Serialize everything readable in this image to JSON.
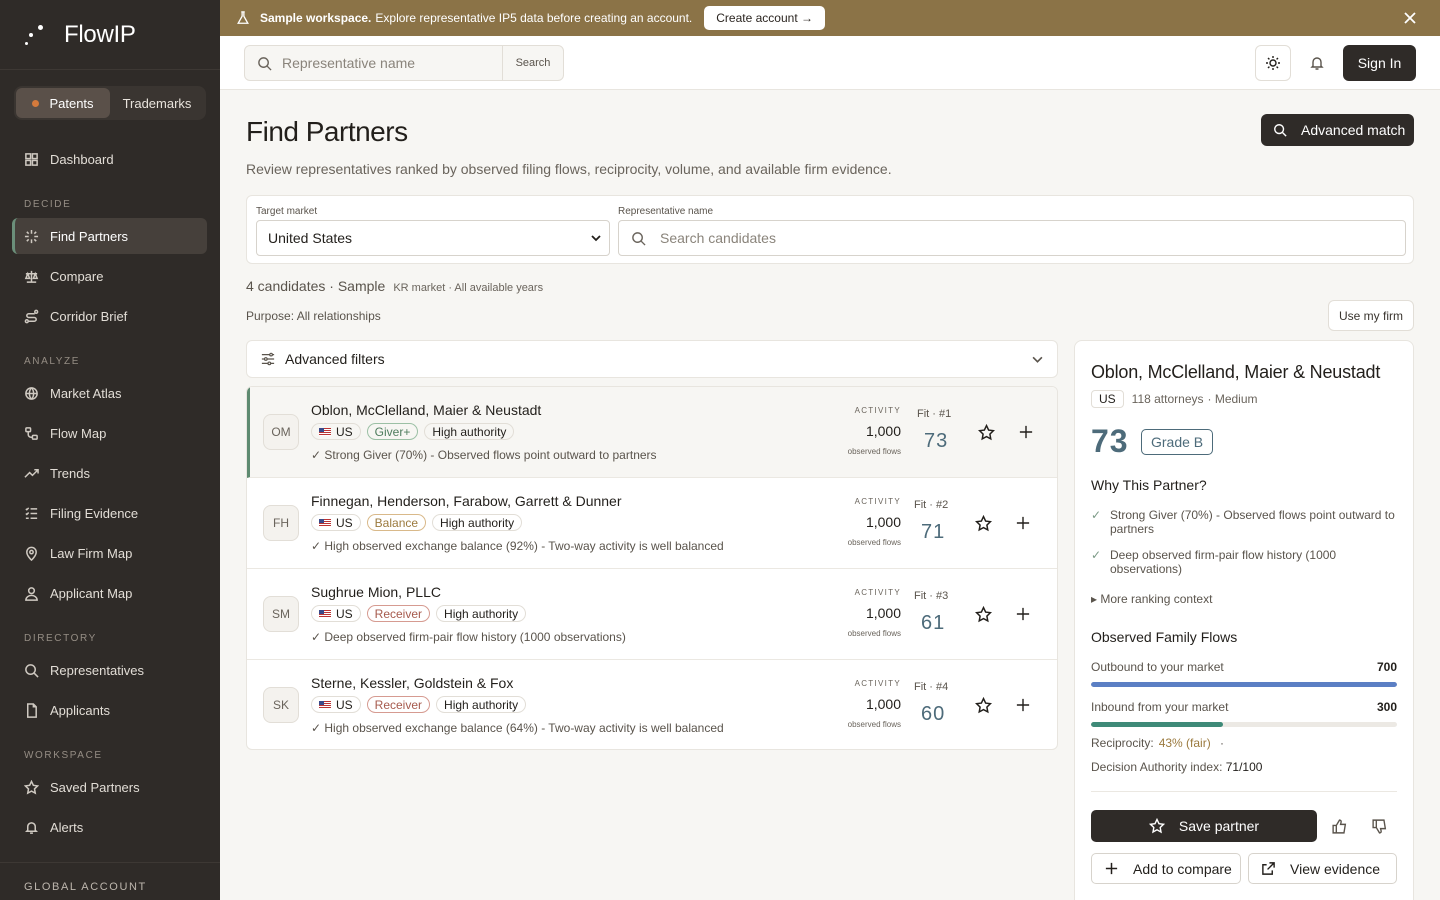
{
  "app": {
    "name": "FlowIP"
  },
  "sidebar": {
    "segments": [
      {
        "label": "Patents"
      },
      {
        "label": "Trademarks"
      }
    ],
    "dashboard": "Dashboard",
    "sections": {
      "decide": "DECIDE",
      "analyze": "ANALYZE",
      "directory": "DIRECTORY",
      "workspace": "WORKSPACE",
      "global": "GLOBAL ACCOUNT"
    },
    "items": {
      "find_partners": "Find Partners",
      "compare": "Compare",
      "corridor_brief": "Corridor Brief",
      "market_atlas": "Market Atlas",
      "flow_map": "Flow Map",
      "trends": "Trends",
      "filing_evidence": "Filing Evidence",
      "law_firm_map": "Law Firm Map",
      "applicant_map": "Applicant Map",
      "representatives": "Representatives",
      "applicants": "Applicants",
      "saved_partners": "Saved Partners",
      "alerts": "Alerts"
    }
  },
  "banner": {
    "strong": "Sample workspace.",
    "text": "Explore representative IP5 data before creating an account.",
    "cta": "Create account →"
  },
  "topbar": {
    "search_placeholder": "Representative name",
    "search_button": "Search",
    "signin": "Sign In"
  },
  "main": {
    "title": "Find Partners",
    "subtitle": "Review representatives ranked by observed filing flows, reciprocity, volume, and available firm evidence.",
    "advanced_match": "Advanced match",
    "filters": {
      "target_label": "Target market",
      "target_value": "United States",
      "rep_label": "Representative name",
      "rep_placeholder": "Search candidates"
    },
    "count": "4 candidates · Sample",
    "count_meta": "KR market · All available years",
    "purpose": "Purpose: All relationships",
    "use_my_firm": "Use my firm",
    "advanced_filters": "Advanced filters",
    "activity_label": "ACTIVITY",
    "activity_sub": "observed flows",
    "candidates": [
      {
        "initials": "OM",
        "name": "Oblon, McClelland, Maier & Neustadt",
        "country": "US",
        "role": "Giver+",
        "authority": "High authority",
        "reason": "✓ Strong Giver (70%) - Observed flows point outward to partners",
        "activity": "1,000",
        "fit_label": "Fit · #1",
        "fit": "73"
      },
      {
        "initials": "FH",
        "name": "Finnegan, Henderson, Farabow, Garrett & Dunner",
        "country": "US",
        "role": "Balance",
        "authority": "High authority",
        "reason": "✓ High observed exchange balance (92%) - Two-way activity is well balanced",
        "activity": "1,000",
        "fit_label": "Fit · #2",
        "fit": "71"
      },
      {
        "initials": "SM",
        "name": "Sughrue Mion, PLLC",
        "country": "US",
        "role": "Receiver",
        "authority": "High authority",
        "reason": "✓ Deep observed firm-pair flow history (1000 observations)",
        "activity": "1,000",
        "fit_label": "Fit · #3",
        "fit": "61"
      },
      {
        "initials": "SK",
        "name": "Sterne, Kessler, Goldstein & Fox",
        "country": "US",
        "role": "Receiver",
        "authority": "High authority",
        "reason": "✓ High observed exchange balance (64%) - Two-way activity is well balanced",
        "activity": "1,000",
        "fit_label": "Fit · #4",
        "fit": "60"
      }
    ]
  },
  "detail": {
    "name": "Oblon, McClelland, Maier & Neustadt",
    "country": "US",
    "attorneys": "118 attorneys",
    "size": "· Medium",
    "score": "73",
    "grade": "Grade B",
    "why_title": "Why This Partner?",
    "why": [
      "Strong Giver (70%) - Observed flows point outward to partners",
      "Deep observed firm-pair flow history (1000 observations)"
    ],
    "more": "▸ More ranking context",
    "flows_title": "Observed Family Flows",
    "outbound_label": "Outbound to your market",
    "outbound_value": "700",
    "outbound_fraction": 1.0,
    "inbound_label": "Inbound from your market",
    "inbound_value": "300",
    "inbound_fraction": 0.43,
    "reciprocity_label": "Reciprocity:",
    "reciprocity_value": "43% (fair)",
    "reciprocity_dot": "·",
    "authority_label": "Decision Authority index:",
    "authority_value": "71/100",
    "save": "Save partner",
    "add_compare": "Add to compare",
    "view_evidence": "View evidence"
  },
  "colors": {
    "accent": "#4d6b7a",
    "outbound": "#5b7fc4",
    "inbound": "#3e8a78",
    "banner": "#8b7347"
  }
}
